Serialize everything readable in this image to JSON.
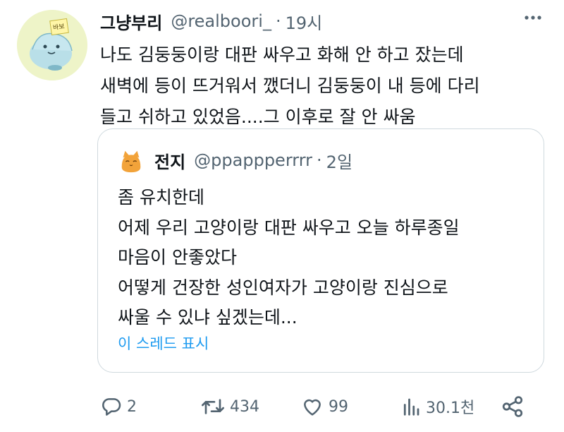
{
  "tweet": {
    "display_name": "그냥부리",
    "handle": "@realboori_",
    "separator": "·",
    "time": "19시",
    "avatar_label": "바보",
    "lines": [
      "나도 김둥둥이랑 대판 싸우고 화해 안 하고 잤는데",
      "새벽에 등이 뜨거워서 깼더니 김둥둥이 내 등에 다리",
      "들고 쉬하고 있었음....그 이후로 잘 안 싸움"
    ]
  },
  "quote": {
    "display_name": "전지",
    "handle": "@ppappperrrr",
    "separator": "·",
    "time": "2일",
    "lines": [
      "좀 유치한데",
      "어제 우리 고양이랑 대판 싸우고 오늘 하루종일",
      "마음이 안좋았다",
      "어떻게 건장한 성인여자가 고양이랑 진심으로",
      "싸울 수 있냐 싶겠는데..."
    ],
    "show_thread": "이 스레드 표시"
  },
  "actions": {
    "replies": "2",
    "retweets": "434",
    "likes": "99",
    "views": "30.1천"
  },
  "icons": {
    "more": "more-options-icon",
    "reply": "reply-icon",
    "retweet": "retweet-icon",
    "like": "heart-icon",
    "views": "views-bar-chart-icon",
    "share": "share-icon"
  },
  "colors": {
    "text": "#0f1419",
    "secondary": "#536471",
    "link": "#1d9bf0",
    "border": "#cfd9de"
  }
}
